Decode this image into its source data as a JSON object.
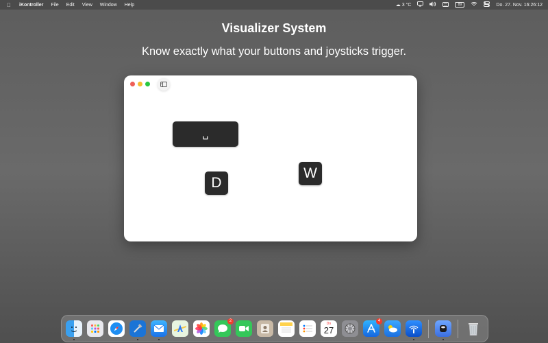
{
  "menubar": {
    "app_name": "iKontroller",
    "items": [
      "File",
      "Edit",
      "View",
      "Window",
      "Help"
    ],
    "weather": "3 °C",
    "battery": "89",
    "datetime": "Do. 27. Nov.  16:26:12"
  },
  "headline": {
    "title": "Visualizer System",
    "subtitle": "Know exactly what your buttons and joysticks trigger."
  },
  "visualizer": {
    "keys": {
      "space": "␣",
      "d": "D",
      "w": "W"
    }
  },
  "dock": {
    "messages_badge": "2",
    "appstore_badge": "4",
    "calendar_day_label": "Do",
    "calendar_date": "27"
  },
  "colors": {
    "key_background": "#2b2b2b",
    "traffic_red": "#ee5f57",
    "traffic_yellow": "#f5bd2f",
    "traffic_green": "#29c840"
  }
}
